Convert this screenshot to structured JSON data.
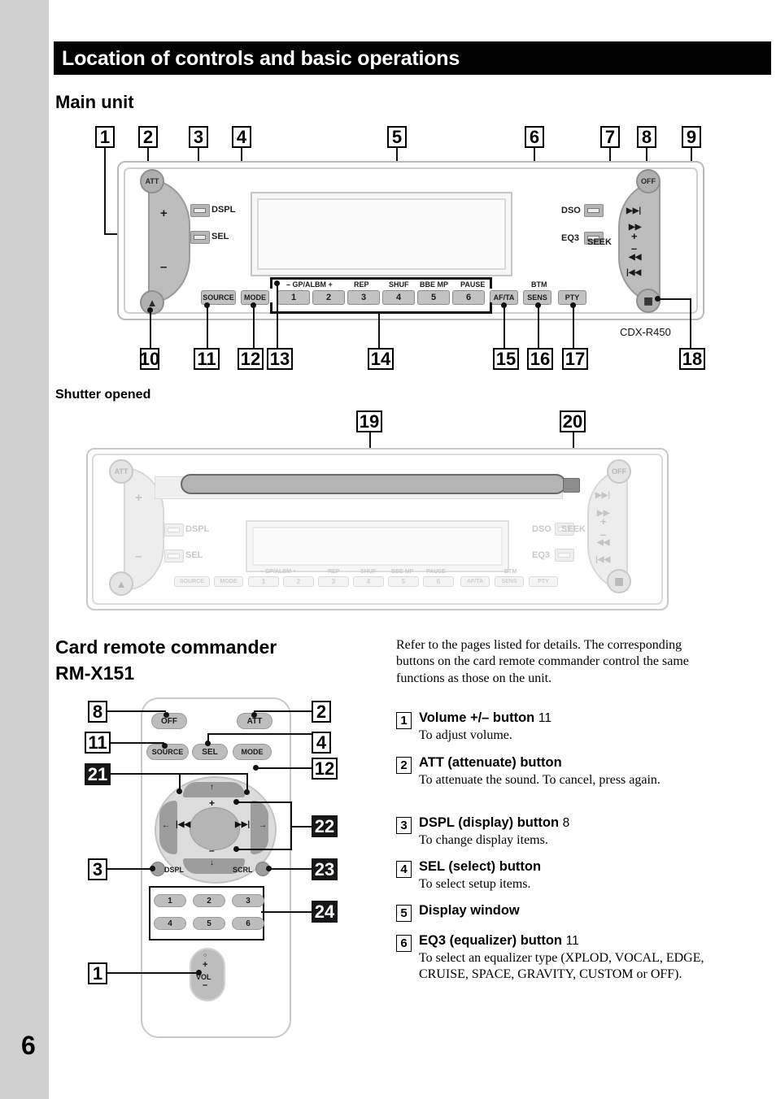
{
  "page": {
    "number": "6",
    "chapter_title": "Location of controls and basic operations"
  },
  "sections": {
    "main_unit": "Main unit",
    "shutter_opened": "Shutter opened",
    "card_remote": "Card remote commander",
    "card_remote_model": "RM-X151"
  },
  "main_unit": {
    "model_number": "CDX-R450",
    "controls": {
      "att": "ATT",
      "off": "OFF",
      "dspl": "DSPL",
      "sel": "SEL",
      "dso": "DSO",
      "eq3": "EQ3",
      "seek": "SEEK",
      "source": "SOURCE",
      "mode": "MODE",
      "af_ta": "AF/TA",
      "sens": "SENS",
      "pty": "PTY",
      "btm": "BTM",
      "plus": "+",
      "minus": "–",
      "vol_plus": "+",
      "vol_minus": "–",
      "next_track": "▶▶|",
      "prev_track": "|◀◀",
      "fast_fwd": "▶▶",
      "fast_rew": "◀◀"
    },
    "preset_keys": [
      {
        "number": "1",
        "label": "– GP/ALBM +"
      },
      {
        "number": "2",
        "label": ""
      },
      {
        "number": "3",
        "label": "REP"
      },
      {
        "number": "4",
        "label": "SHUF"
      },
      {
        "number": "5",
        "label": "BBE MP"
      },
      {
        "number": "6",
        "label": "PAUSE"
      }
    ],
    "callouts": [
      "1",
      "2",
      "3",
      "4",
      "5",
      "6",
      "7",
      "8",
      "9",
      "10",
      "11",
      "12",
      "13",
      "14",
      "15",
      "16",
      "17",
      "18"
    ]
  },
  "shutter": {
    "callouts": [
      "19",
      "20"
    ]
  },
  "remote": {
    "callouts_white": [
      "8",
      "2",
      "11",
      "4",
      "12",
      "3",
      "1"
    ],
    "callouts_black": [
      "21",
      "22",
      "23",
      "24"
    ],
    "buttons": {
      "off": "OFF",
      "att": "ATT",
      "source": "SOURCE",
      "sel": "SEL",
      "mode": "MODE",
      "dspl": "DSPL",
      "scrl": "SCRL",
      "vol": "VOL",
      "vol_plus": "+",
      "vol_minus": "–",
      "pad_up": "+",
      "pad_down": "–",
      "pad_prev": "|◀◀",
      "pad_next": "▶▶|",
      "pad_left": "←",
      "pad_right": "→",
      "pad_top_arrow": "↑",
      "pad_bottom_arrow": "↓"
    },
    "preset_keys": [
      "1",
      "2",
      "3",
      "4",
      "5",
      "6"
    ]
  },
  "right_column": {
    "intro": "Refer to the pages listed for details. The corresponding buttons on the card remote commander control the same functions as those on the unit.",
    "items": [
      {
        "num": "1",
        "title": "Volume +/– button",
        "page": "11",
        "desc": "To adjust volume."
      },
      {
        "num": "2",
        "title": "ATT (attenuate) button",
        "page": "",
        "desc": "To attenuate the sound. To cancel, press again."
      },
      {
        "num": "3",
        "title": "DSPL (display) button",
        "page": "8",
        "desc": "To change display items."
      },
      {
        "num": "4",
        "title": "SEL (select) button",
        "page": "",
        "desc": "To select setup items."
      },
      {
        "num": "5",
        "title": "Display window",
        "page": "",
        "desc": ""
      },
      {
        "num": "6",
        "title": "EQ3 (equalizer) button",
        "page": "11",
        "desc": "To select an equalizer type (XPLOD, VOCAL, EDGE, CRUISE, SPACE, GRAVITY, CUSTOM or OFF)."
      }
    ]
  },
  "colors": {
    "header_bg": "#000000",
    "gutter": "#d0d0d0",
    "callout_black": "#17171a"
  }
}
